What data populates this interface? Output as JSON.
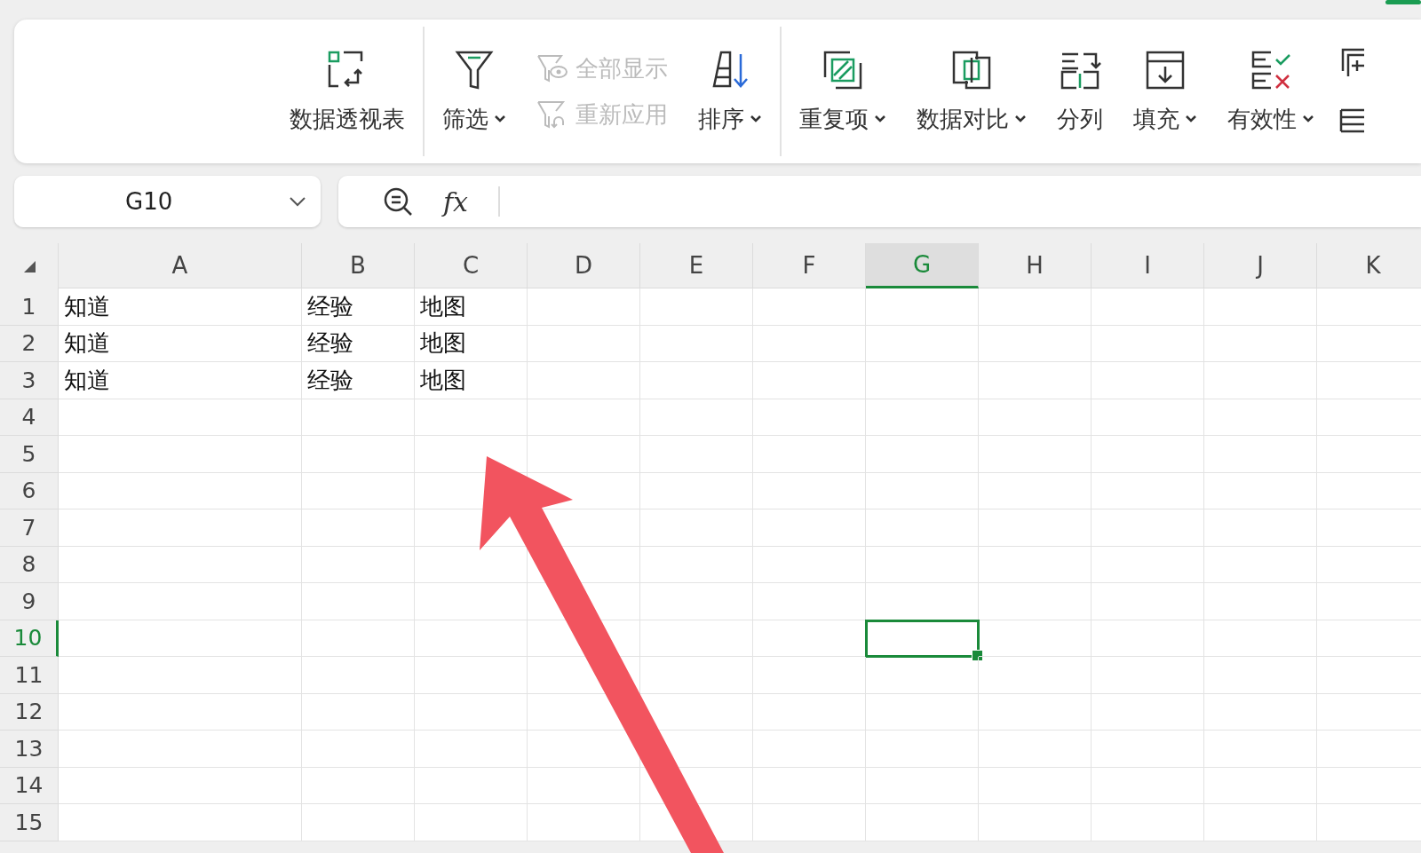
{
  "toolbar": {
    "groups": [
      {
        "items": [
          {
            "kind": "large",
            "label": "数据透视表",
            "caret": false,
            "disabled": false
          }
        ]
      },
      {
        "items": [
          {
            "kind": "large",
            "label": "筛选",
            "caret": true,
            "disabled": false
          },
          {
            "kind": "stack",
            "children": [
              {
                "label": "全部显示",
                "disabled": true
              },
              {
                "label": "重新应用",
                "disabled": true
              }
            ]
          },
          {
            "kind": "large",
            "label": "排序",
            "caret": true,
            "disabled": false
          }
        ]
      },
      {
        "items": [
          {
            "kind": "large",
            "label": "重复项",
            "caret": true,
            "disabled": false
          },
          {
            "kind": "large",
            "label": "数据对比",
            "caret": true,
            "disabled": false
          },
          {
            "kind": "large",
            "label": "分列",
            "caret": false,
            "disabled": false
          },
          {
            "kind": "large",
            "label": "填充",
            "caret": true,
            "disabled": false
          },
          {
            "kind": "large",
            "label": "有效性",
            "caret": true,
            "disabled": false
          }
        ]
      }
    ]
  },
  "name_box": {
    "value": "G10"
  },
  "formula_bar": {
    "fx_label": "fx"
  },
  "sheet": {
    "columns": [
      {
        "label": "A",
        "selected": false
      },
      {
        "label": "B",
        "selected": false
      },
      {
        "label": "C",
        "selected": false
      },
      {
        "label": "D",
        "selected": false
      },
      {
        "label": "E",
        "selected": false
      },
      {
        "label": "F",
        "selected": false
      },
      {
        "label": "G",
        "selected": true
      },
      {
        "label": "H",
        "selected": false
      },
      {
        "label": "I",
        "selected": false
      },
      {
        "label": "J",
        "selected": false
      },
      {
        "label": "K",
        "selected": false
      }
    ],
    "rows": [
      {
        "label": "1",
        "selected": false,
        "cells": [
          "知道",
          "经验",
          "地图"
        ]
      },
      {
        "label": "2",
        "selected": false,
        "cells": [
          "知道",
          "经验",
          "地图"
        ]
      },
      {
        "label": "3",
        "selected": false,
        "cells": [
          "知道",
          "经验",
          "地图"
        ]
      },
      {
        "label": "4",
        "selected": false
      },
      {
        "label": "5",
        "selected": false
      },
      {
        "label": "6",
        "selected": false
      },
      {
        "label": "7",
        "selected": false
      },
      {
        "label": "8",
        "selected": false
      },
      {
        "label": "9",
        "selected": false
      },
      {
        "label": "10",
        "selected": true
      },
      {
        "label": "11",
        "selected": false
      },
      {
        "label": "12",
        "selected": false
      },
      {
        "label": "13",
        "selected": false
      },
      {
        "label": "14",
        "selected": false
      },
      {
        "label": "15",
        "selected": false
      }
    ]
  }
}
